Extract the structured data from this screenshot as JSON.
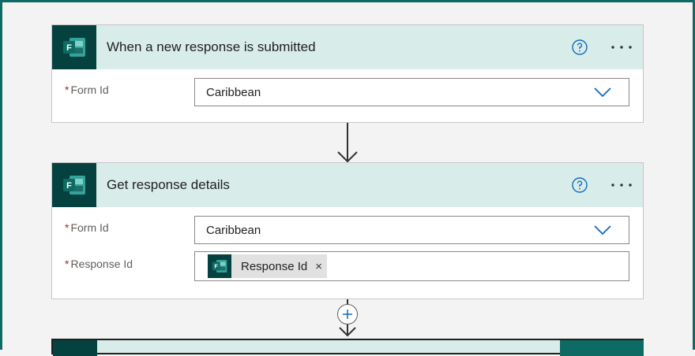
{
  "trigger": {
    "title": "When a new response is submitted",
    "icon": "microsoft-forms-icon",
    "fields": [
      {
        "label": "Form Id",
        "required": "*",
        "value": "Caribbean"
      }
    ]
  },
  "action": {
    "title": "Get response details",
    "icon": "microsoft-forms-icon",
    "fields": [
      {
        "label": "Form Id",
        "required": "*",
        "value": "Caribbean"
      },
      {
        "label": "Response Id",
        "required": "*",
        "token": "Response Id",
        "token_remove": "×"
      }
    ]
  },
  "colors": {
    "header_bg": "#d8ecea",
    "icon_bg": "#04413f",
    "accent_blue": "#0f6cbd",
    "required_red": "#a4262c"
  }
}
